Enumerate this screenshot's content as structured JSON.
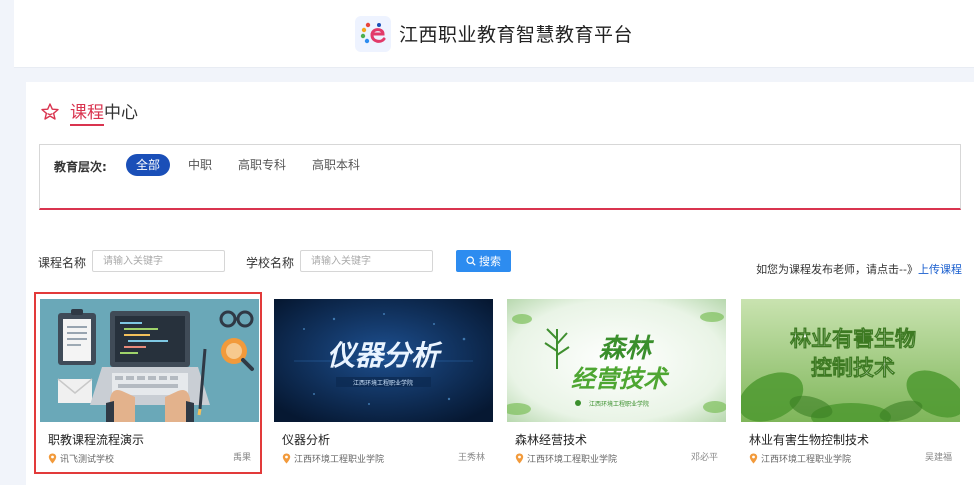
{
  "header": {
    "title": "江西职业教育智慧教育平台"
  },
  "section": {
    "title_highlight": "课程",
    "title_rest": "中心"
  },
  "filter": {
    "label": "教育层次:",
    "options": [
      {
        "label": "全部",
        "active": true
      },
      {
        "label": "中职",
        "active": false
      },
      {
        "label": "高职专科",
        "active": false
      },
      {
        "label": "高职本科",
        "active": false
      }
    ]
  },
  "search": {
    "course_label": "课程名称",
    "course_placeholder": "请输入关键字",
    "school_label": "学校名称",
    "school_placeholder": "请输入关键字",
    "button_label": "搜索",
    "upload_tip": "如您为课程发布老师，请点击--》",
    "upload_link": "上传课程"
  },
  "courses": [
    {
      "title": "职教课程流程演示",
      "school": "讯飞测试学校",
      "teacher": "禹果",
      "selected": true
    },
    {
      "title": "仪器分析",
      "school": "江西环境工程职业学院",
      "teacher": "王秀林",
      "cover_text": "仪器分析",
      "cover_sub": "江西环境工程职业学院"
    },
    {
      "title": "森林经营技术",
      "school": "江西环境工程职业学院",
      "teacher": "邓必平",
      "cover_text": "森林经营技术",
      "cover_line1": "森林",
      "cover_line2": "经营技术",
      "cover_sub": "江西环境工程职业学院"
    },
    {
      "title": "林业有害生物控制技术",
      "school": "江西环境工程职业学院",
      "teacher": "吴建福",
      "cover_line1": "林业有害生物",
      "cover_line2": "控制技术"
    }
  ],
  "colors": {
    "accent": "#d9344f",
    "primary": "#1a4fb8",
    "button": "#2d8cf0",
    "selection": "#e23a3a",
    "link": "#1a5fcf"
  },
  "icons": {
    "logo": "platform-logo-icon",
    "section": "flower-outline-icon",
    "search": "search-icon",
    "location": "location-pin-icon"
  }
}
